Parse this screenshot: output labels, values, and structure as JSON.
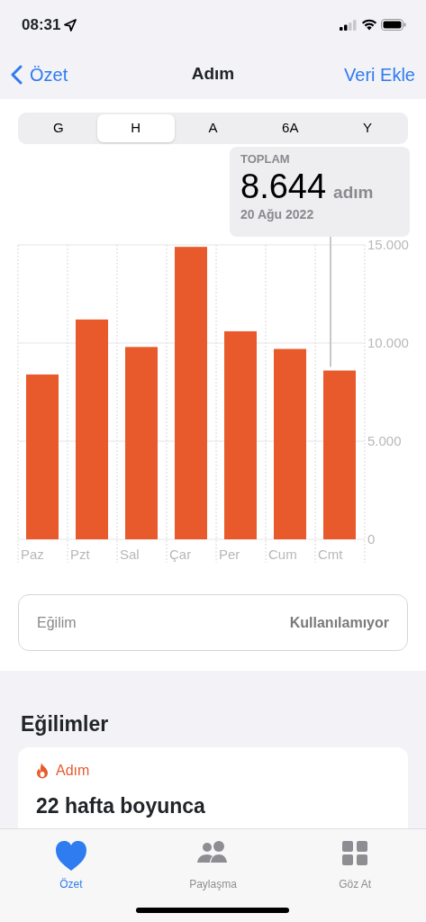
{
  "status_bar": {
    "time": "08:31"
  },
  "nav": {
    "back": "Özet",
    "title": "Adım",
    "action": "Veri Ekle"
  },
  "segments": [
    {
      "label": "G",
      "selected": false
    },
    {
      "label": "H",
      "selected": true
    },
    {
      "label": "A",
      "selected": false
    },
    {
      "label": "6A",
      "selected": false
    },
    {
      "label": "Y",
      "selected": false
    }
  ],
  "summary": {
    "caption": "TOPLAM",
    "value": "8.644",
    "unit": "adım",
    "date": "20 Ağu 2022"
  },
  "chart_data": {
    "type": "bar",
    "categories": [
      "Paz",
      "Pzt",
      "Sal",
      "Çar",
      "Per",
      "Cum",
      "Cmt"
    ],
    "series": [
      {
        "color": "#e85a2c",
        "values": [
          8400,
          11200,
          9800,
          14900,
          10600,
          9700,
          8600
        ]
      }
    ],
    "ylim": [
      0,
      15000
    ],
    "yticks": [
      {
        "value": 0,
        "label": "0"
      },
      {
        "value": 5000,
        "label": "5.000"
      },
      {
        "value": 10000,
        "label": "10.000"
      },
      {
        "value": 15000,
        "label": "15.000"
      }
    ]
  },
  "trend_row": {
    "label": "Eğilim",
    "value": "Kullanılamıyor"
  },
  "trends": {
    "heading": "Eğilimler",
    "card": {
      "metric": "Adım",
      "text": "22 hafta boyunca"
    }
  },
  "tab_bar": [
    {
      "label": "Özet",
      "selected": true
    },
    {
      "label": "Paylaşma",
      "selected": false
    },
    {
      "label": "Göz At",
      "selected": false
    }
  ]
}
